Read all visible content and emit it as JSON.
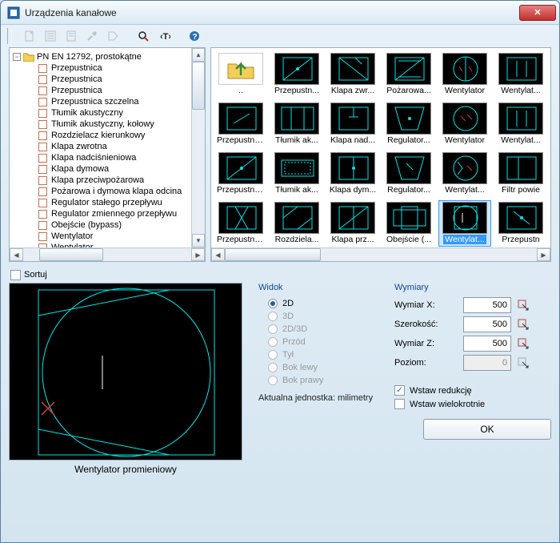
{
  "window": {
    "title": "Urządzenia kanałowe"
  },
  "tree": {
    "root": "PN EN 12792, prostokątne",
    "items": [
      "Przepustnica",
      "Przepustnica",
      "Przepustnica",
      "Przepustnica szczelna",
      "Tłumik akustyczny",
      "Tłumik akustyczny, kołowy",
      "Rozdzielacz kierunkowy",
      "Klapa zwrotna",
      "Klapa nadciśnieniowa",
      "Klapa dymowa",
      "Klapa przeciwpożarowa",
      "Pożarowa i dymowa klapa odcina",
      "Regulator stałego przepływu",
      "Regulator zmiennego przepływu",
      "Obejście (bypass)",
      "Wentylator",
      "Wentylator"
    ]
  },
  "thumbnails": {
    "items": [
      {
        "label": "..",
        "folder": true
      },
      {
        "label": "Przepustn..."
      },
      {
        "label": "Klapa zwr..."
      },
      {
        "label": "Pożarowa..."
      },
      {
        "label": "Wentylator"
      },
      {
        "label": "Wentylat..."
      },
      {
        "label": "Przepustnica"
      },
      {
        "label": "Tłumik ak..."
      },
      {
        "label": "Klapa nad..."
      },
      {
        "label": "Regulator..."
      },
      {
        "label": "Wentylator"
      },
      {
        "label": "Wentylat..."
      },
      {
        "label": "Przepustnica"
      },
      {
        "label": "Tłumik ak..."
      },
      {
        "label": "Klapa dym..."
      },
      {
        "label": "Regulator..."
      },
      {
        "label": "Wentylat..."
      },
      {
        "label": "Filtr powie"
      },
      {
        "label": "Przepustnica"
      },
      {
        "label": "Rozdziela..."
      },
      {
        "label": "Klapa prz..."
      },
      {
        "label": "Obejście (..."
      },
      {
        "label": "Wentylat...",
        "selected": true
      },
      {
        "label": "Przepustn"
      }
    ]
  },
  "sort": {
    "label": "Sortuj",
    "checked": false
  },
  "preview": {
    "caption": "Wentylator promieniowy"
  },
  "view": {
    "section": "Widok",
    "options": [
      {
        "label": "2D",
        "checked": true,
        "enabled": true
      },
      {
        "label": "3D",
        "checked": false,
        "enabled": false
      },
      {
        "label": "2D/3D",
        "checked": false,
        "enabled": false
      },
      {
        "label": "Przód",
        "checked": false,
        "enabled": false
      },
      {
        "label": "Tył",
        "checked": false,
        "enabled": false
      },
      {
        "label": "Bok lewy",
        "checked": false,
        "enabled": false
      },
      {
        "label": "Bok prawy",
        "checked": false,
        "enabled": false
      }
    ],
    "unit_label": "Aktualna jednostka:",
    "unit_value": "milimetry"
  },
  "dims": {
    "section": "Wymiary",
    "rows": [
      {
        "label": "Wymiar X:",
        "value": "500",
        "enabled": true
      },
      {
        "label": "Szerokość:",
        "value": "500",
        "enabled": true
      },
      {
        "label": "Wymiar Z:",
        "value": "500",
        "enabled": true
      },
      {
        "label": "Poziom:",
        "value": "0",
        "enabled": false
      }
    ],
    "reduce": {
      "label": "Wstaw redukcję",
      "checked": true
    },
    "multi": {
      "label": "Wstaw wielokrotnie",
      "checked": false
    }
  },
  "ok": "OK"
}
